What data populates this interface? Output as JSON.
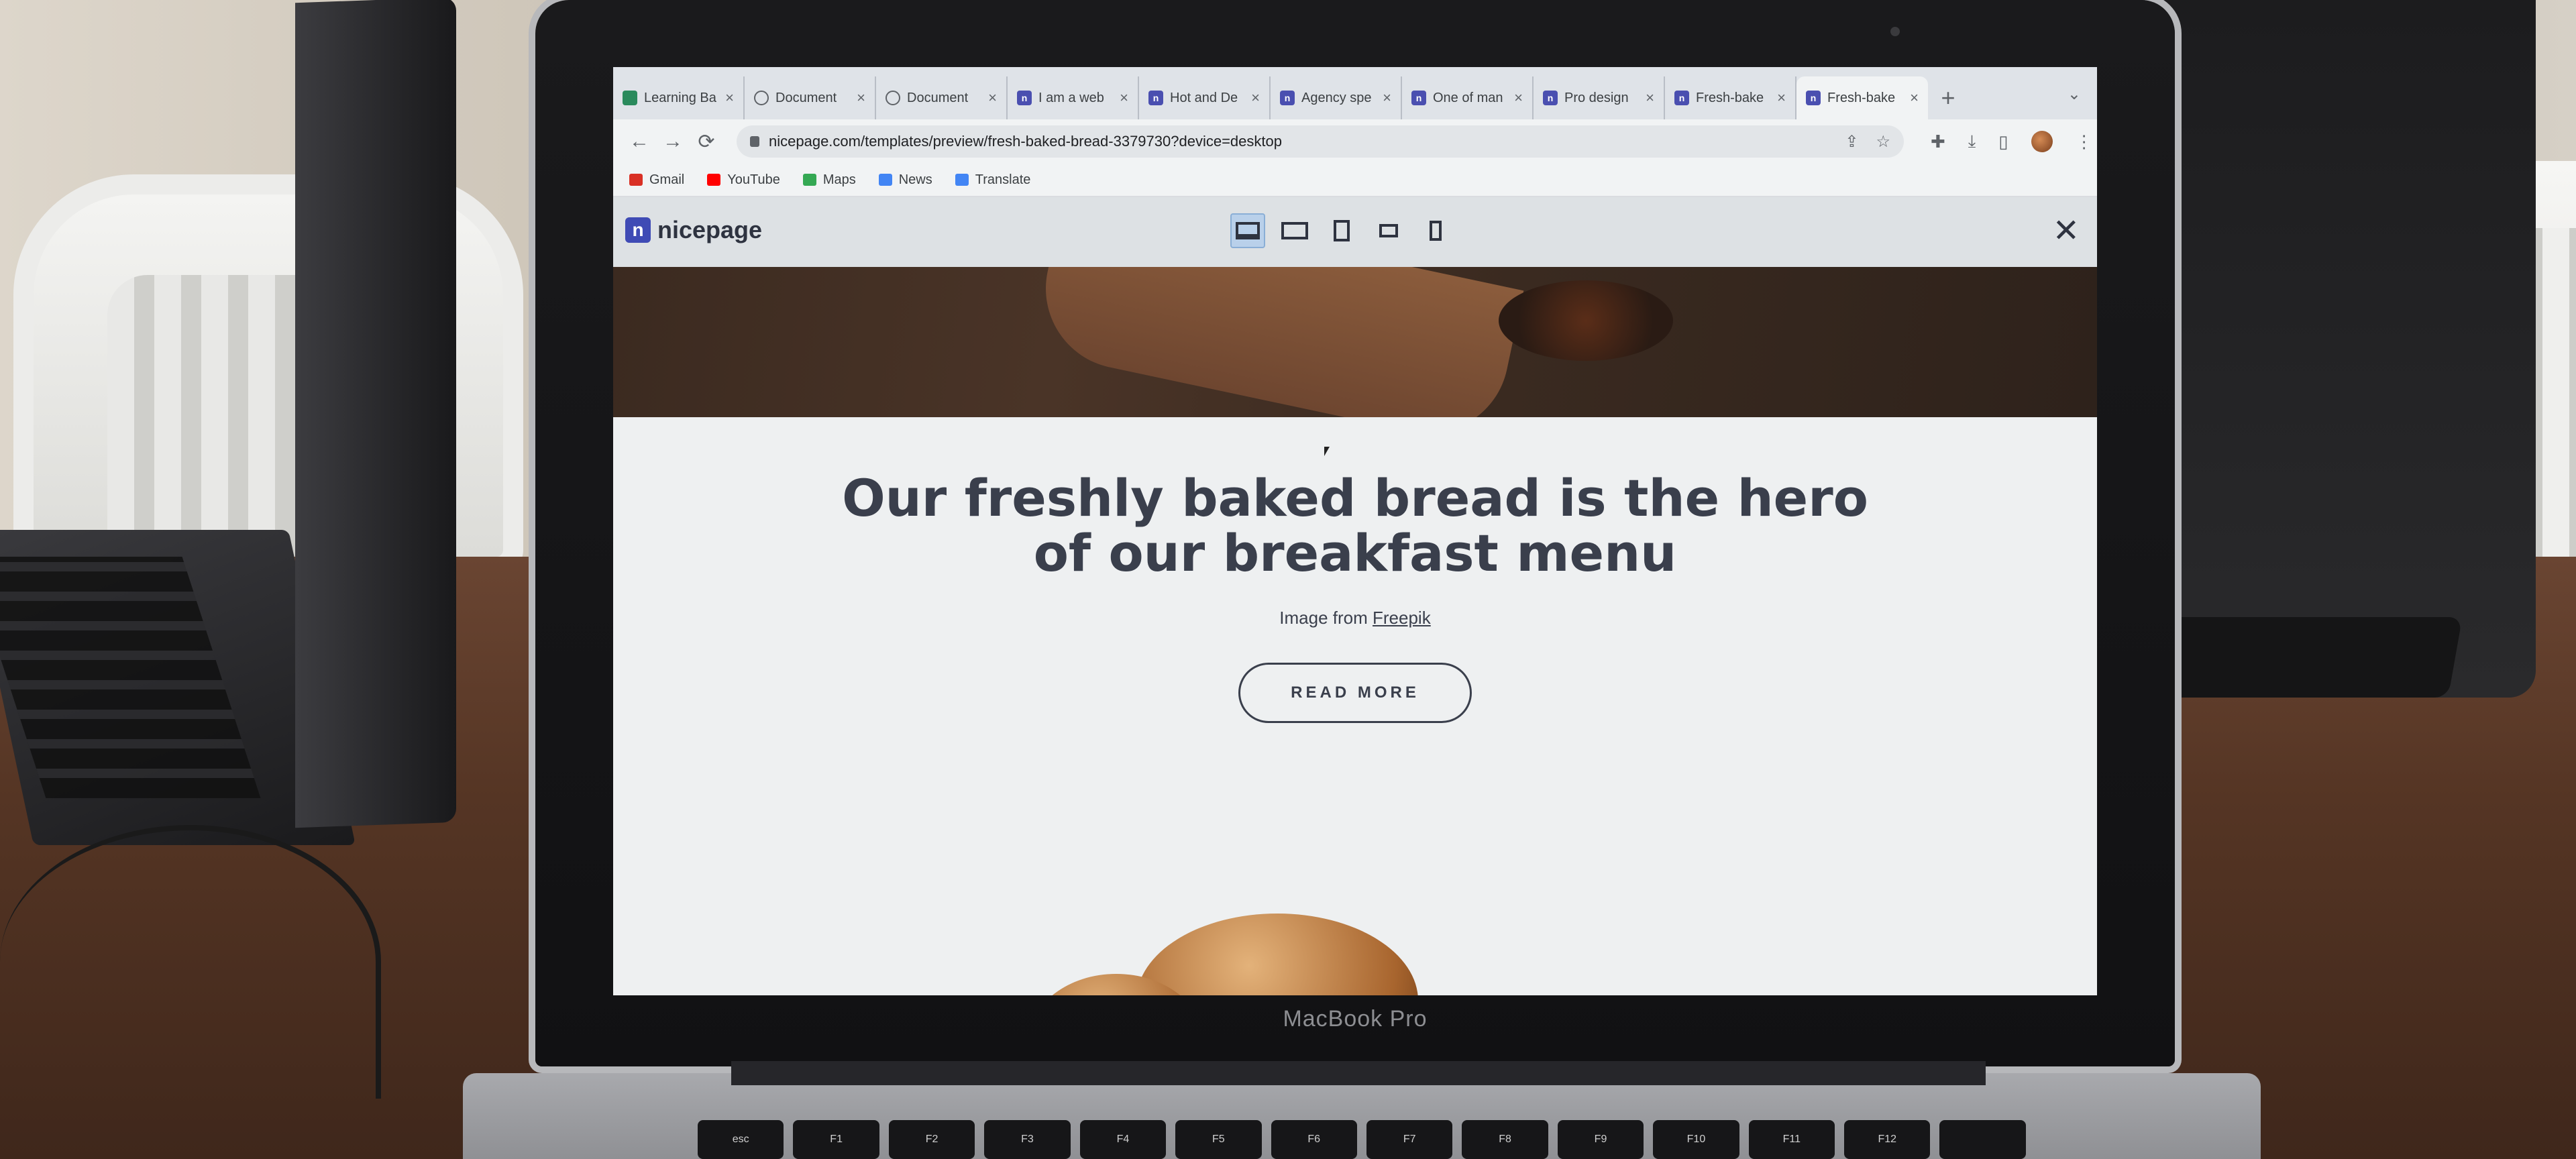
{
  "browser": {
    "tabs": [
      {
        "label": "Learning Ba",
        "favicon": "green-book-icon",
        "active": false
      },
      {
        "label": "Document",
        "favicon": "globe-icon",
        "active": false
      },
      {
        "label": "Document",
        "favicon": "globe-icon",
        "active": false
      },
      {
        "label": "I am a web",
        "favicon": "nicepage-icon",
        "active": false
      },
      {
        "label": "Hot and De",
        "favicon": "nicepage-icon",
        "active": false
      },
      {
        "label": "Agency spe",
        "favicon": "nicepage-icon",
        "active": false
      },
      {
        "label": "One of man",
        "favicon": "nicepage-icon",
        "active": false
      },
      {
        "label": "Pro design",
        "favicon": "nicepage-icon",
        "active": false
      },
      {
        "label": "Fresh-bake",
        "favicon": "nicepage-icon",
        "active": false
      },
      {
        "label": "Fresh-bake",
        "favicon": "nicepage-icon",
        "active": true
      }
    ],
    "new_tab": "+",
    "url": "nicepage.com/templates/preview/fresh-baked-bread-3379730?device=desktop",
    "bookmarks": [
      {
        "label": "Gmail",
        "color": "#d93025"
      },
      {
        "label": "YouTube",
        "color": "#ff0000"
      },
      {
        "label": "Maps",
        "color": "#34a853"
      },
      {
        "label": "News",
        "color": "#4285f4"
      },
      {
        "label": "Translate",
        "color": "#4285f4"
      }
    ]
  },
  "preview_header": {
    "logo_mark": "n",
    "logo_text": "nicepage",
    "devices": [
      "desktop-icon",
      "laptop-icon",
      "tablet-icon",
      "tablet-landscape-icon",
      "phone-icon"
    ],
    "selected_device": "desktop-icon",
    "close": "✕"
  },
  "page": {
    "headline_line1": "Our freshly baked bread is the hero",
    "headline_line2": "of our breakfast menu",
    "credit_prefix": "Image from",
    "credit_link": "Freepik",
    "button": "READ MORE"
  },
  "device": {
    "bezel_label": "MacBook Pro",
    "keys": [
      "esc",
      "F1",
      "F2",
      "F3",
      "F4",
      "F5",
      "F6",
      "F7",
      "F8",
      "F9",
      "F10",
      "F11",
      "F12",
      ""
    ]
  },
  "colors": {
    "heading": "#3a3f4c",
    "content_bg": "#eef0f1",
    "nicepage_brand": "#3f4bb5",
    "selected_device_bg": "#b9d0ea"
  }
}
